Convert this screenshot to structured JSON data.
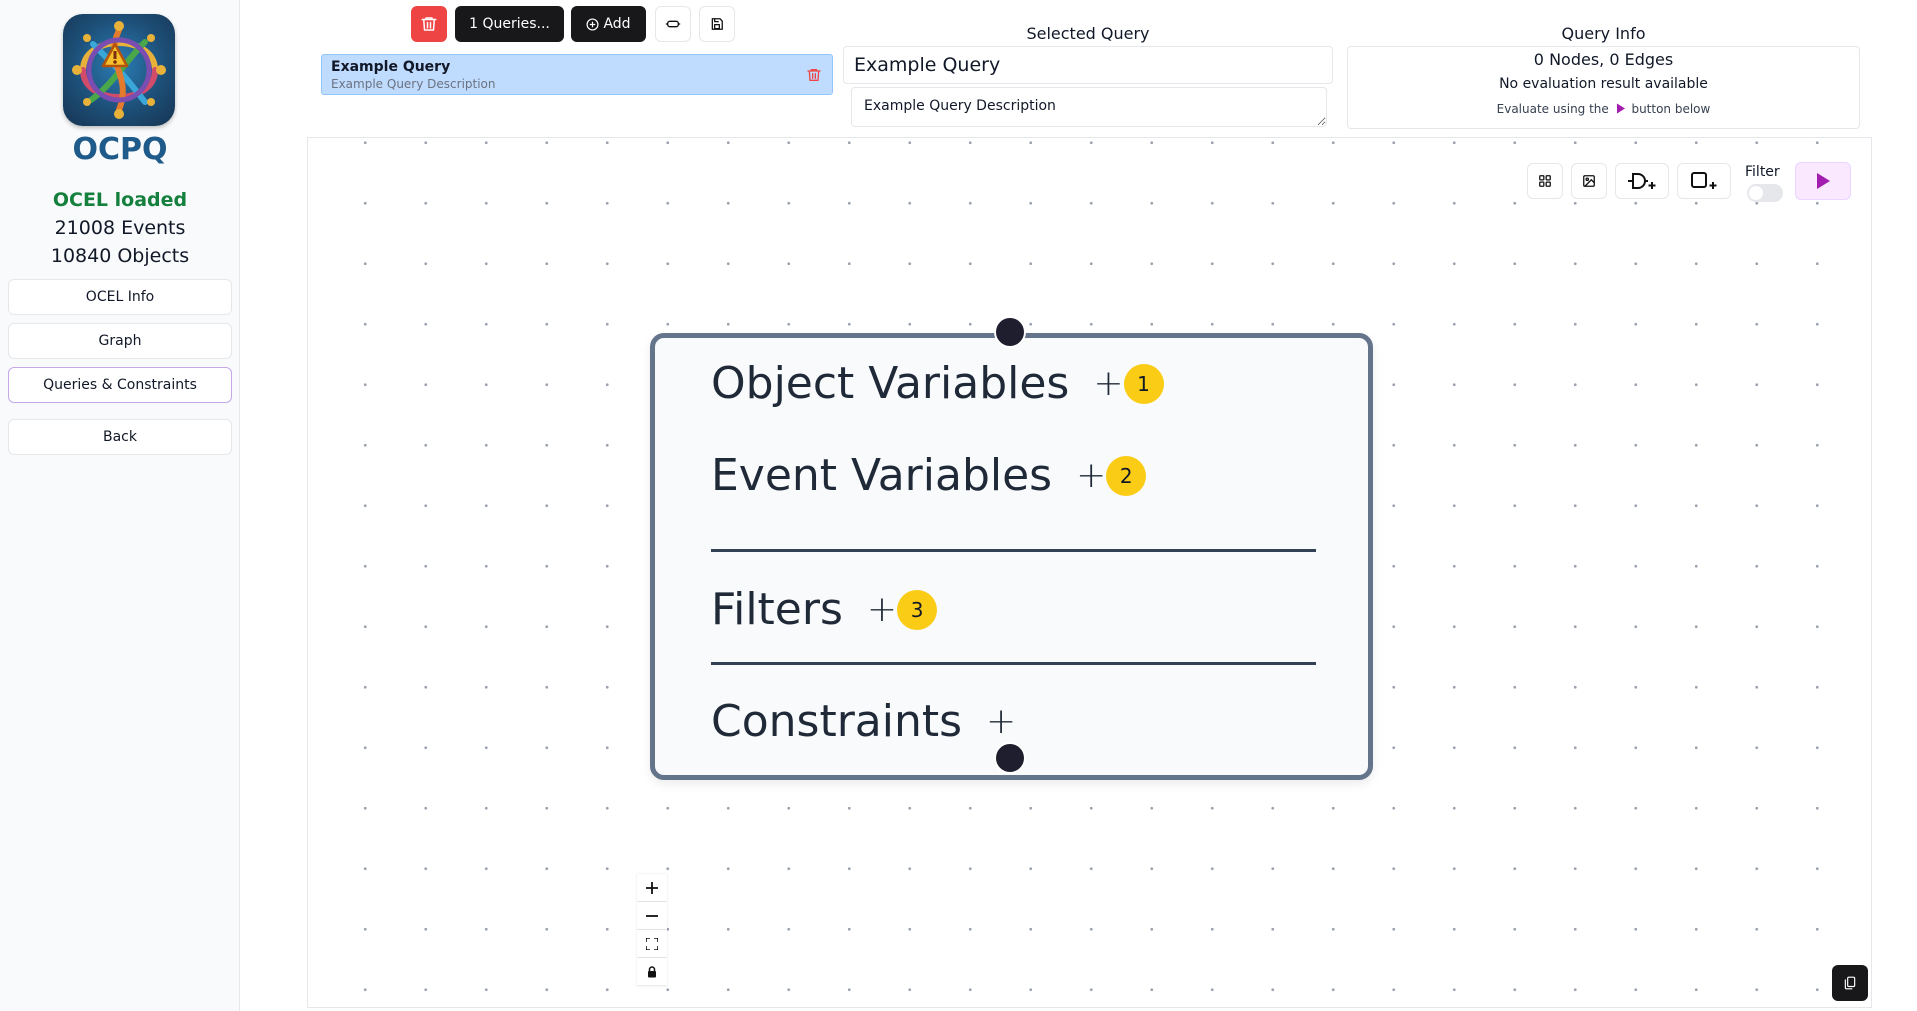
{
  "sidebar": {
    "app_name": "OCPQ",
    "ocel_status": "OCEL loaded",
    "events_count": "21008 Events",
    "objects_count": "10840 Objects",
    "nav": [
      {
        "label": "OCEL Info"
      },
      {
        "label": "Graph"
      },
      {
        "label": "Queries & Constraints"
      },
      {
        "label": "Back"
      }
    ]
  },
  "toolbar": {
    "queries_label": "1 Queries...",
    "add_label": "Add"
  },
  "query_list": [
    {
      "name": "Example Query",
      "description": "Example Query Description"
    }
  ],
  "selected_query": {
    "heading": "Selected Query",
    "name": "Example Query",
    "description": "Example Query Description"
  },
  "query_info": {
    "heading": "Query Info",
    "summary": "0 Nodes, 0 Edges",
    "result": "No evaluation result available",
    "hint_prefix": "Evaluate using the",
    "hint_suffix": "button below"
  },
  "canvas": {
    "filter_label": "Filter",
    "filter_enabled": false
  },
  "node": {
    "object_variables": "Object Variables",
    "event_variables": "Event Variables",
    "filters": "Filters",
    "constraints": "Constraints",
    "plus": "+",
    "badges": {
      "object_variables": "1",
      "event_variables": "2",
      "filters": "3"
    }
  },
  "colors": {
    "accent": "#1e5a8a",
    "loaded": "#15803d",
    "danger": "#ef4444",
    "run": "#a21caf",
    "badge": "#facc15",
    "selected_item": "#bfdbfe"
  }
}
